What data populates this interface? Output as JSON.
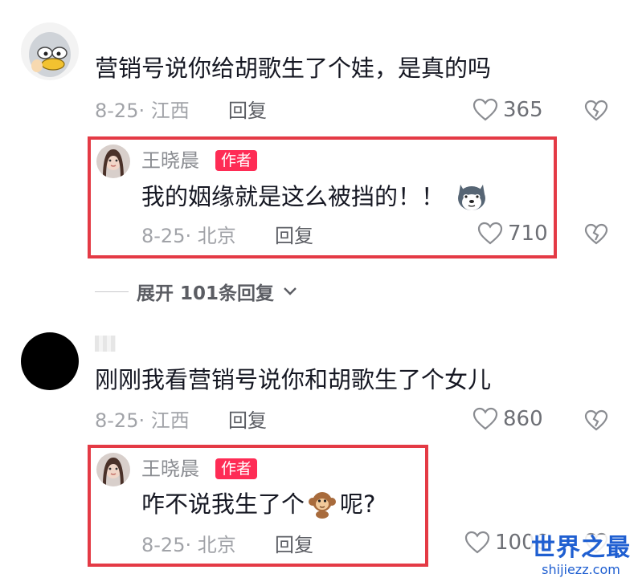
{
  "comments": [
    {
      "username": "",
      "text": "营销号说你给胡歌生了个娃，是真的吗",
      "date": "8-25",
      "location": "江西",
      "reply_label": "回复",
      "likes": "365",
      "author_reply": {
        "username": "王晓晨",
        "badge": "作者",
        "text": "我的姻缘就是这么被挡的！！",
        "emoji": "husky-emoji",
        "date": "8-25",
        "location": "北京",
        "reply_label": "回复",
        "likes": "710"
      },
      "expand_label": "展开 101条回复"
    },
    {
      "username": "",
      "text": "刚刚我看营销号说你和胡歌生了个女儿",
      "date": "8-25",
      "location": "江西",
      "reply_label": "回复",
      "likes": "860",
      "author_reply": {
        "username": "王晓晨",
        "badge": "作者",
        "text_before": "咋不说我生了个",
        "text_after": "呢?",
        "emoji": "monkey-emoji",
        "date": "8-25",
        "location": "北京",
        "reply_label": "回复",
        "likes": "1006"
      }
    }
  ],
  "watermark": {
    "title": "世界之最",
    "url": "shijiezz.com"
  },
  "colors": {
    "highlight": "#e43a45",
    "badge": "#fe2c55",
    "watermark": "#1f5fd1"
  }
}
